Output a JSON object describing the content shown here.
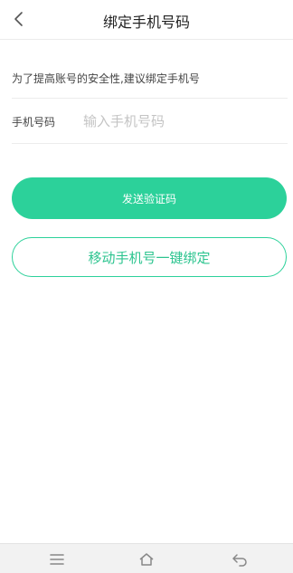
{
  "header": {
    "title": "绑定手机号码",
    "back_icon": "chevron-left-icon"
  },
  "main": {
    "hint_text": "为了提高账号的安全性,建议绑定手机号",
    "phone": {
      "label": "手机号码",
      "placeholder": "输入手机号码",
      "value": ""
    },
    "send_code_button": "发送验证码",
    "one_click_bind_button": "移动手机号一键绑定"
  },
  "navbar": {
    "icons": [
      "menu-icon",
      "home-icon",
      "back-icon"
    ]
  },
  "colors": {
    "accent": "#2cd19a",
    "accent_text": "#2cc48f"
  }
}
